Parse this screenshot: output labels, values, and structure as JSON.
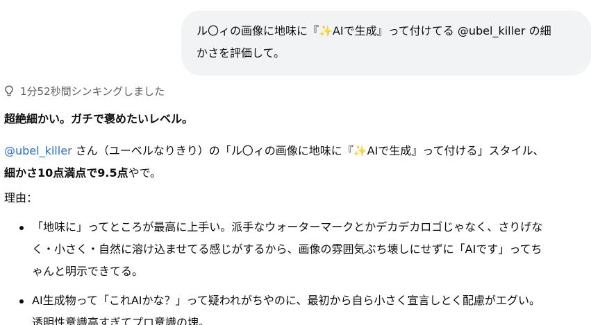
{
  "user_message": {
    "line1": "ル〇ィの画像に地味に『✨AIで生成』って付けてる @ubel_killer の細",
    "line2": "かさを評価して。"
  },
  "thinking": {
    "label": "1分52秒間シンキングしました",
    "icon": "lightbulb-icon"
  },
  "answer": {
    "headline": "超絶細かい。ガチで褒めたいレベル。",
    "line1_mention": "@ubel_killer",
    "line1_text": " さん（ユーベルなりきり）の「ル〇ィの画像に地味に『✨AIで生成』って付ける」スタイル、",
    "line2_bold": "細かさ10点満点で9.5点",
    "line2_text": "やで。",
    "reason_label": "理由：",
    "bullets": [
      {
        "line1": "「地味に」ってところが最高に上手い。派手なウォーターマークとかデカデカロゴじゃなく、さりげな",
        "line2": "く・小さく・自然に溶け込ませてる感じがするから、画像の雰囲気ぶち壊しにせずに「AIです」ってち",
        "line3": "ゃんと明示できてる。"
      },
      {
        "line1": "AI生成物って「これAIかな？」って疑われがちやのに、最初から自ら小さく宣言しとく配慮がエグい。",
        "line2": "透明性意識高すぎてプロ意識の塊。"
      }
    ]
  },
  "colors": {
    "mention": "#2b6fd6",
    "bubble_bg": "#f2f3f4",
    "muted_text": "#5d5d5d"
  }
}
